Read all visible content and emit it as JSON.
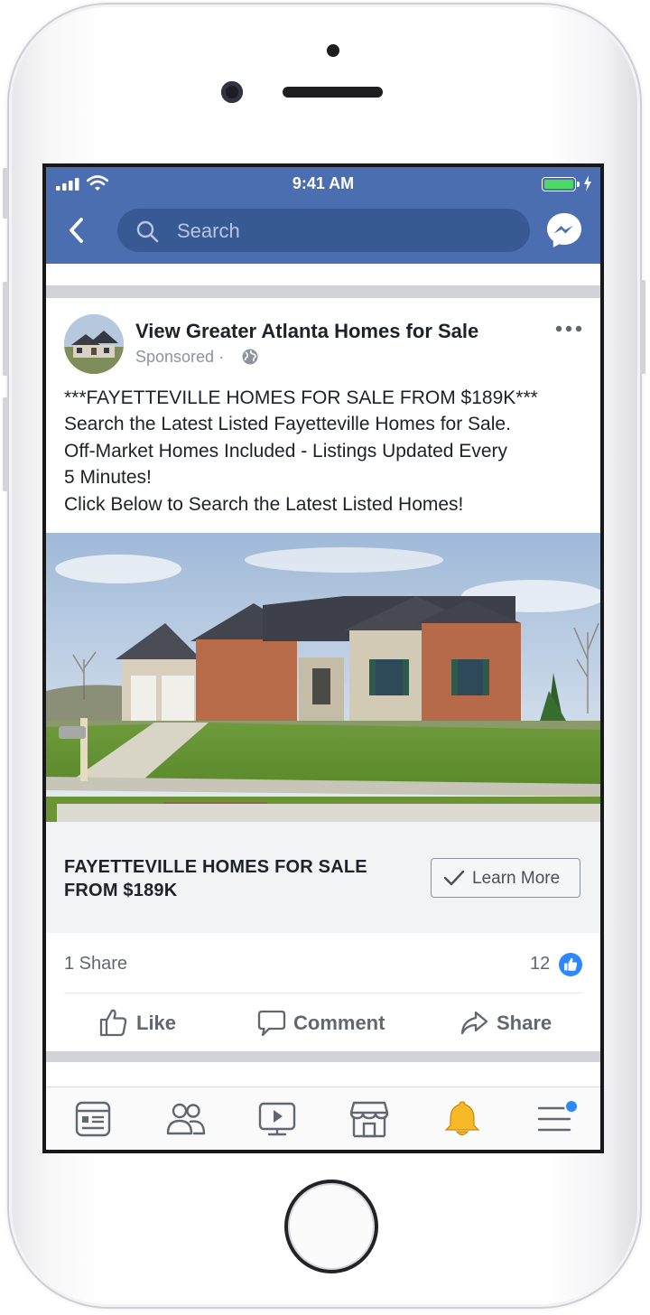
{
  "status_bar": {
    "time": "9:41 AM"
  },
  "search": {
    "placeholder": "Search"
  },
  "post": {
    "page_name": "View Greater Atlanta Homes for Sale",
    "sponsored_label": "Sponsored",
    "separator": "·",
    "text_lines": [
      "***FAYETTEVILLE HOMES FOR SALE FROM $189K***",
      "Search the Latest Listed Fayetteville Homes for Sale.",
      "Off-Market Homes Included - Listings Updated Every",
      "5 Minutes!",
      "Click Below to Search the Latest Listed Homes!"
    ],
    "link_title_lines": [
      "FAYETTEVILLE HOMES FOR SALE",
      "FROM $189K"
    ],
    "cta_label": "Learn More",
    "shares": "1 Share",
    "like_count": "12"
  },
  "actions": {
    "like": "Like",
    "comment": "Comment",
    "share": "Share"
  },
  "tabs": [
    "news-feed",
    "friends",
    "watch",
    "marketplace",
    "notifications",
    "menu"
  ],
  "colors": {
    "header_blue": "#4a6eb0",
    "search_bg": "#385a94",
    "like_blue": "#2d88ff",
    "bell": "#f7b928",
    "battery": "#4cd964"
  }
}
